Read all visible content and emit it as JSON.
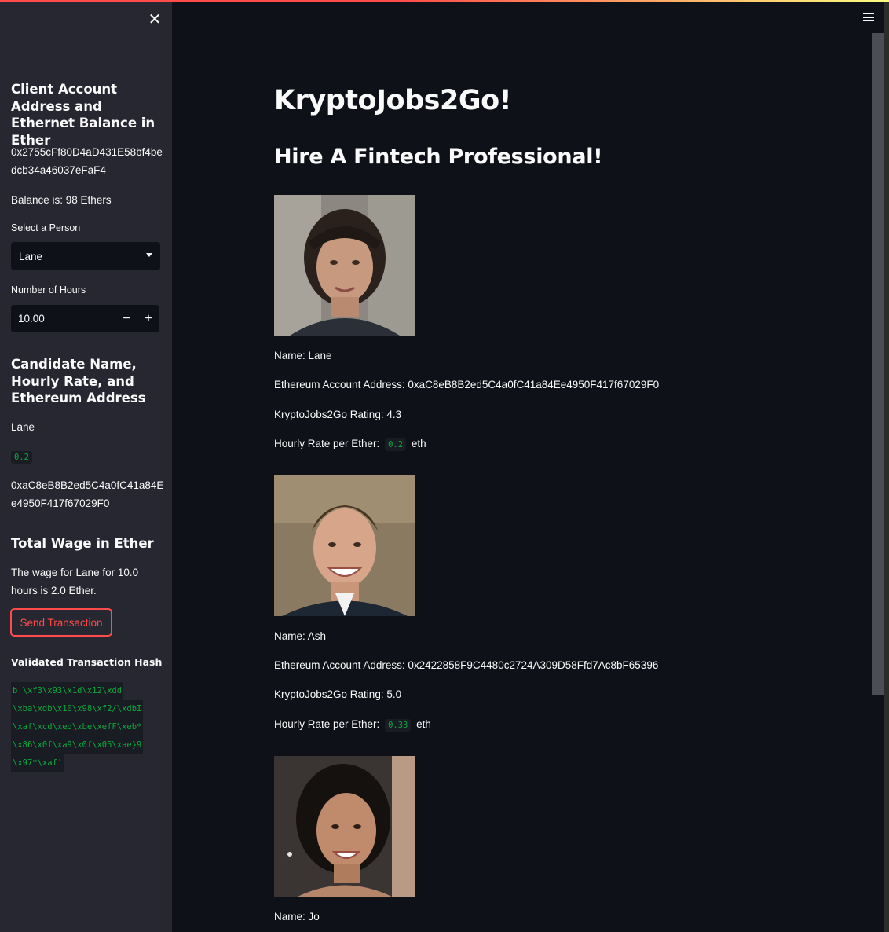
{
  "sidebar": {
    "close_icon": "close-icon",
    "account_heading": "Client Account Address and Ethernet Balance in Ether",
    "account_address": "0x2755cFf80D4aD431E58bf4bedcb34a46037eFaF4",
    "balance_text": "Balance is: 98 Ethers",
    "select_label": "Select a Person",
    "select_value": "Lane",
    "hours_label": "Number of Hours",
    "hours_value": "10.00",
    "minus_label": "−",
    "plus_label": "+",
    "candidate_heading": "Candidate Name, Hourly Rate, and Ethereum Address",
    "candidate_name": "Lane",
    "candidate_rate": "0.2",
    "candidate_address": "0xaC8eB8B2ed5C4a0fC41a84Ee4950F417f67029F0",
    "wage_heading": "Total Wage in Ether",
    "wage_text": "The wage for Lane for 10.0 hours is 2.0 Ether.",
    "send_button": "Send Transaction",
    "hash_heading": "Validated Transaction Hash",
    "hash_lines": [
      "b'\\xf3\\x93\\x1d\\x12\\xdd",
      "\\xba\\xdb\\x10\\x98\\xf2/\\xdbI",
      "\\xaf\\xcd\\xed\\xbe\\xefF\\xeb*",
      "\\x86\\x0f\\xa9\\x0f\\x05\\xae}9",
      "\\x97*\\xaf'"
    ]
  },
  "main": {
    "title": "KryptoJobs2Go!",
    "subtitle": "Hire A Fintech Professional!",
    "candidates": [
      {
        "name": "Name: Lane",
        "address": "Ethereum Account Address: 0xaC8eB8B2ed5C4a0fC41a84Ee4950F417f67029F0",
        "rating": "KryptoJobs2Go Rating: 4.3",
        "rate_prefix": "Hourly Rate per Ether:",
        "rate": "0.2",
        "rate_suffix": "eth"
      },
      {
        "name": "Name: Ash",
        "address": "Ethereum Account Address: 0x2422858F9C4480c2724A309D58Ffd7Ac8bF65396",
        "rating": "KryptoJobs2Go Rating: 5.0",
        "rate_prefix": "Hourly Rate per Ether:",
        "rate": "0.33",
        "rate_suffix": "eth"
      },
      {
        "name": "Name: Jo"
      }
    ]
  },
  "colors": {
    "background": "#0e1117",
    "sidebar": "#262730",
    "accent": "#ff4b4b",
    "code_green": "#09ab3b"
  }
}
